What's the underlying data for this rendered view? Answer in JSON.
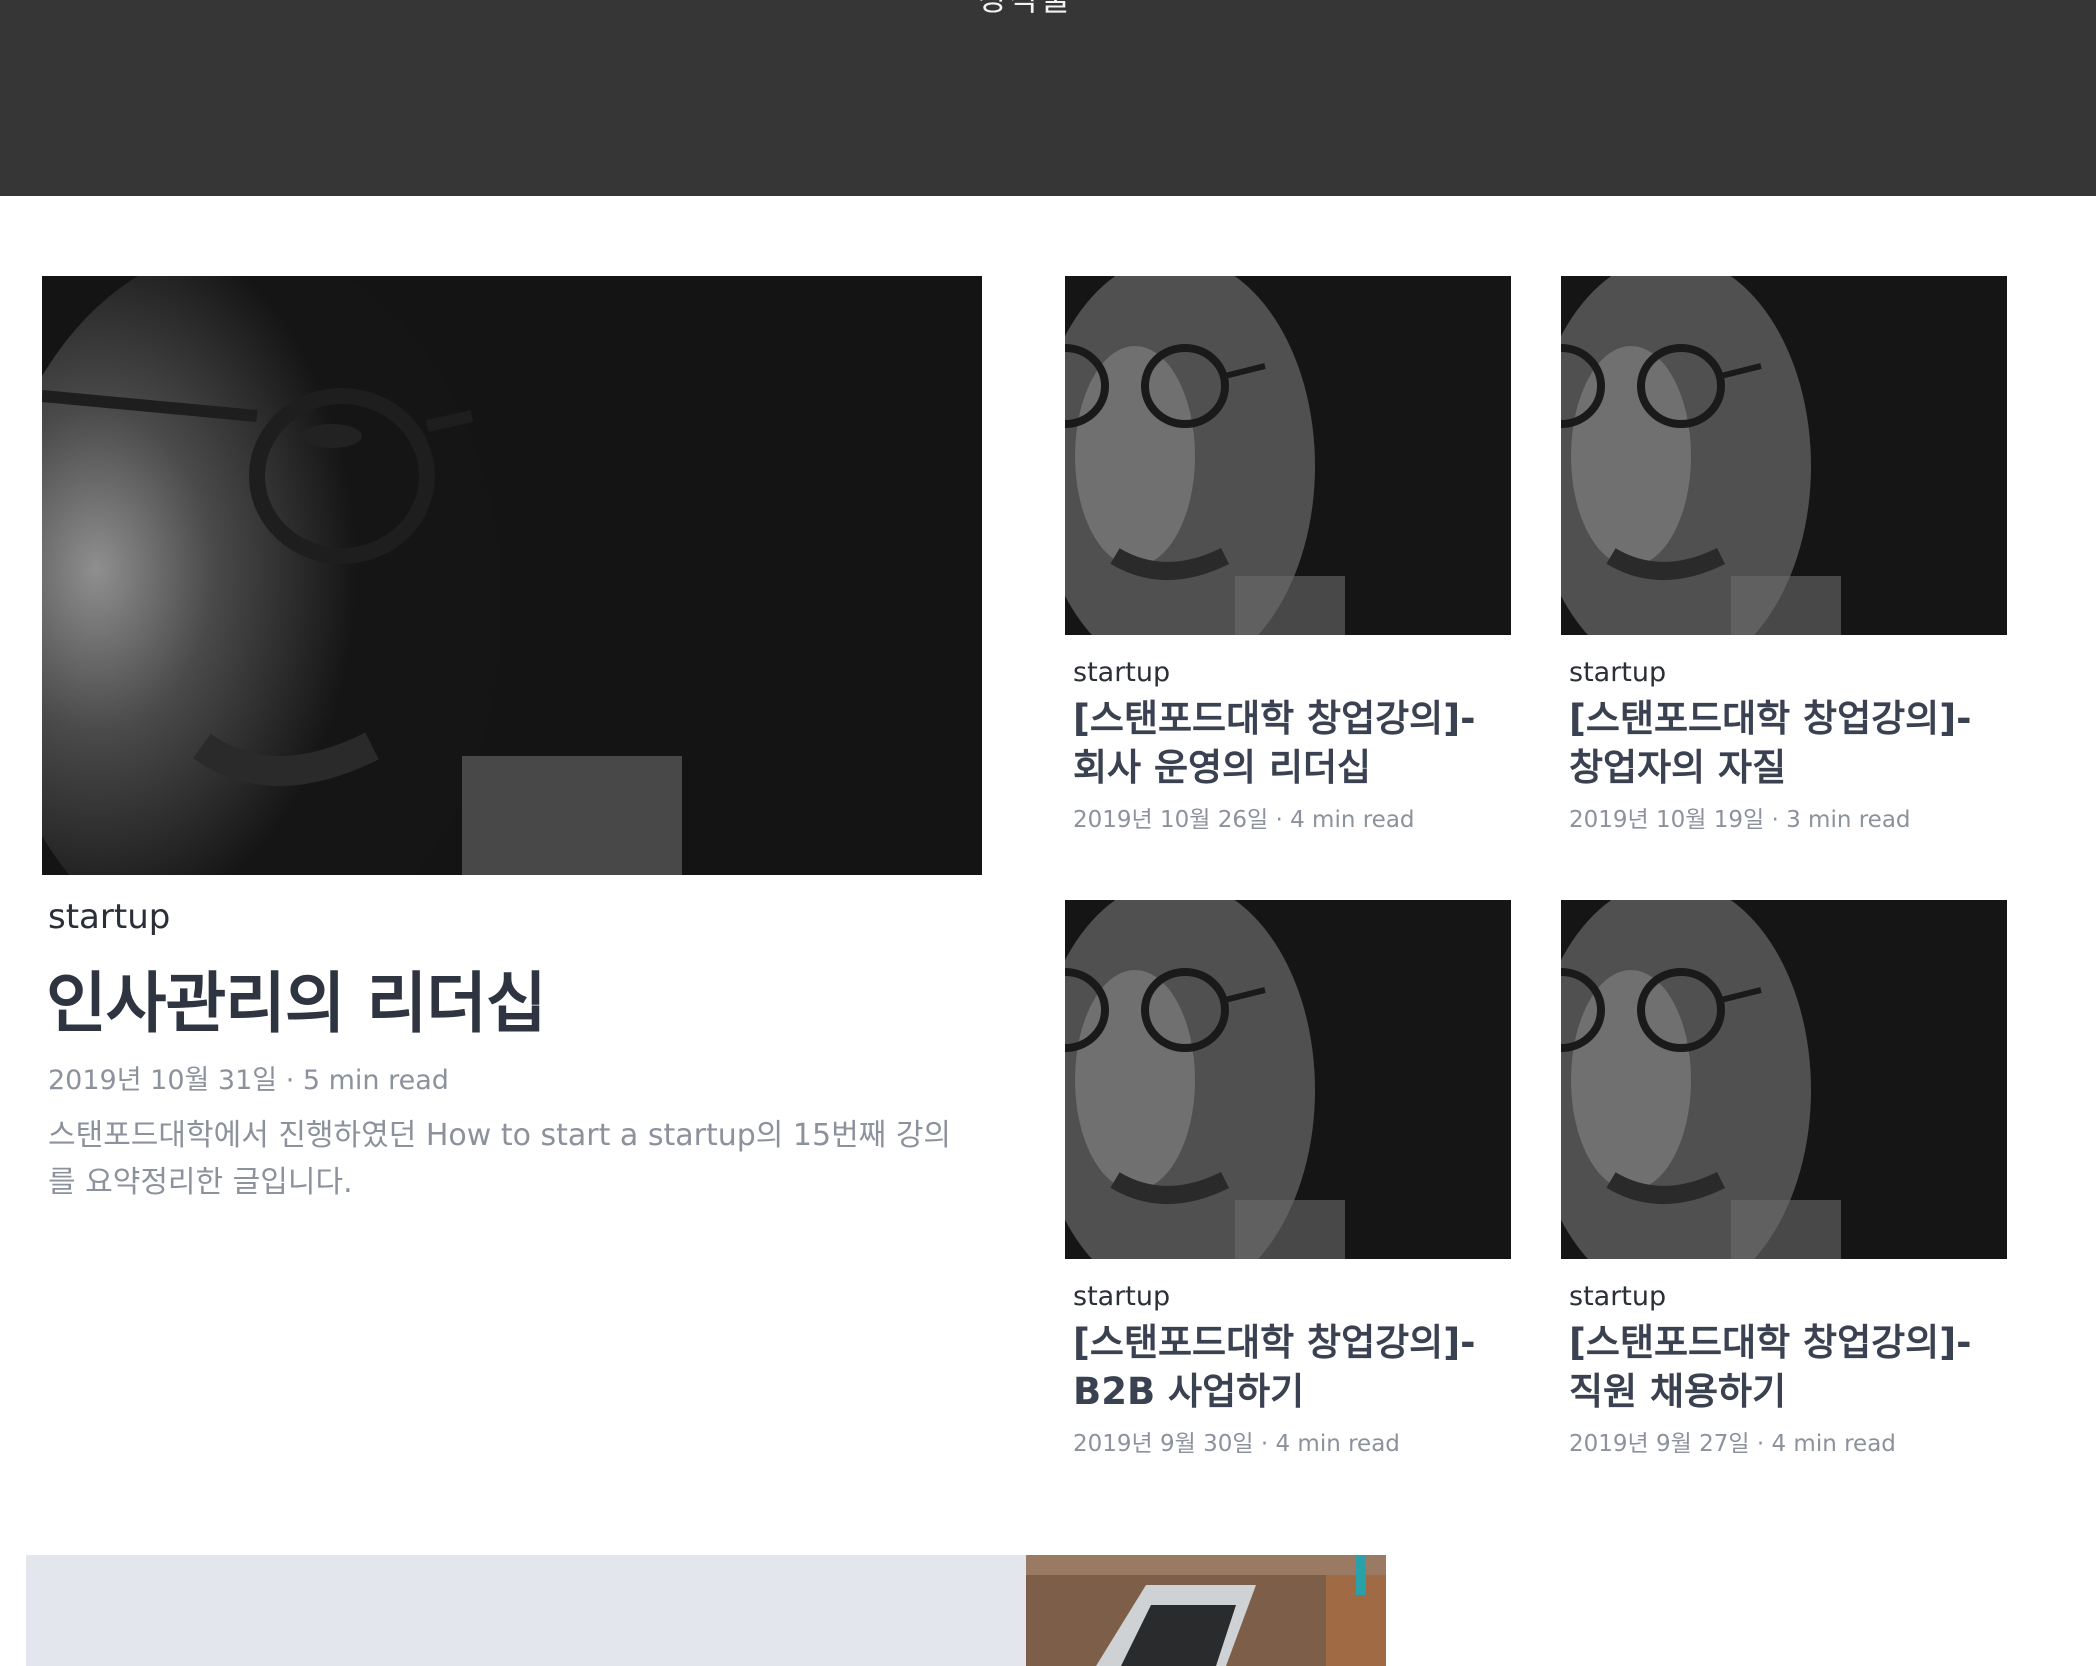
{
  "header": {
    "title": "창작물"
  },
  "featured": {
    "category": "startup",
    "title": "인사관리의 리더십",
    "meta": "2019년 10월 31일 · 5 min read",
    "excerpt": "스탠포드대학에서 진행하였던 How to start a startup의 15번째 강의를 요약정리한 글입니다."
  },
  "posts": [
    {
      "category": "startup",
      "title": "[스탠포드대학 창업강의]- 회사 운영의 리더십",
      "meta": "2019년 10월 26일 · 4 min read"
    },
    {
      "category": "startup",
      "title": "[스탠포드대학 창업강의]- 창업자의 자질",
      "meta": "2019년 10월 19일 · 3 min read"
    },
    {
      "category": "startup",
      "title": "[스탠포드대학 창업강의]- B2B 사업하기",
      "meta": "2019년 9월 30일 · 4 min read"
    },
    {
      "category": "startup",
      "title": "[스탠포드대학 창업강의]- 직원 채용하기",
      "meta": "2019년 9월 27일 · 4 min read"
    }
  ],
  "colors": {
    "header_bg": "#363637",
    "title": "#2e3440",
    "muted": "#8b929c",
    "band": "#e3e6ec"
  }
}
